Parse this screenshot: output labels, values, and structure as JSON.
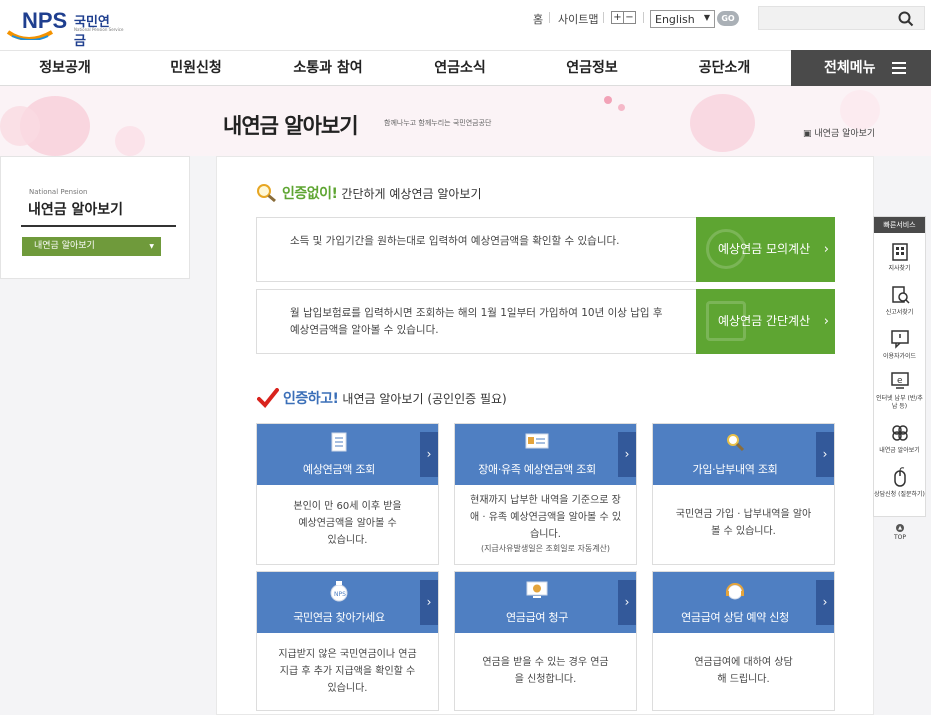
{
  "header": {
    "logo_text": "NPS",
    "logo_korean": "국민연금",
    "logo_english": "National Pension Service",
    "util_home": "홈",
    "util_sitemap": "사이트맵",
    "zoom_in": "+",
    "zoom_out": "−",
    "language": "English",
    "go_label": "GO",
    "search_placeholder": ""
  },
  "gnb": {
    "items": [
      "정보공개",
      "민원신청",
      "소통과 참여",
      "연금소식",
      "연금정보",
      "공단소개"
    ],
    "all_menu": "전체메뉴"
  },
  "banner": {
    "title": "내연금 알아보기",
    "slogan": "함께나누고 함께누리는 국민연금공단",
    "breadcrumb": "내연금 알아보기"
  },
  "lnb": {
    "en": "National Pension",
    "title": "내연금 알아보기",
    "select": "내연금 알아보기"
  },
  "section1": {
    "em": "인증없이!",
    "rest": "간단하게 예상연금 알아보기",
    "boxes": [
      {
        "desc": "소득 및 가입기간을 원하는대로 입력하여 예상연금액을 확인할 수 있습니다.",
        "btn": "예상연금 모의계산"
      },
      {
        "desc": "월 납입보험료를 입력하시면 조회하는 해의 1월 1일부터 가입하여 10년 이상 납입 후 예상연금액을 알아볼 수 있습니다.",
        "btn": "예상연금 간단계산"
      }
    ]
  },
  "section2": {
    "em": "인증하고!",
    "rest": "내연금 알아보기 (공인인증 필요)"
  },
  "cards": [
    {
      "label": "예상연금액 조회",
      "body": "본인이 만 60세 이후 받을 예상연금액을 알아볼 수 있습니다.",
      "note": ""
    },
    {
      "label": "장애·유족 예상연금액 조회",
      "body": "현재까지 납부한 내역을 기준으로 장애 · 유족 예상연금액을 알아볼 수 있습니다.",
      "note": "(지급사유발생일은 조회일로 자동계산)"
    },
    {
      "label": "가입·납부내역 조회",
      "body": "국민연금 가입 · 납부내역을 알아볼 수 있습니다.",
      "note": ""
    },
    {
      "label": "국민연금 찾아가세요",
      "body": "지급받지 않은 국민연금이나 연금지급 후 추가 지급액을 확인할 수 있습니다.",
      "note": ""
    },
    {
      "label": "연금급여 청구",
      "body": "연금을 받을 수 있는 경우 연금을 신청합니다.",
      "note": ""
    },
    {
      "label": "연금급여 상담 예약 신청",
      "body": "연금급여에 대하여 상담해 드립니다.",
      "note": ""
    }
  ],
  "quick": {
    "title": "빠른서비스",
    "items": [
      "지사찾기",
      "신고서찾기",
      "이용자가이드",
      "인터넷 납부 (반/추납 등)",
      "내연금 알아보기",
      "상담신청 (질문하기)"
    ],
    "top": "TOP"
  },
  "colors": {
    "green": "#5ea532",
    "blue": "#4f7fc2",
    "navy": "#1f3f8f",
    "dark": "#4a4a4a"
  }
}
